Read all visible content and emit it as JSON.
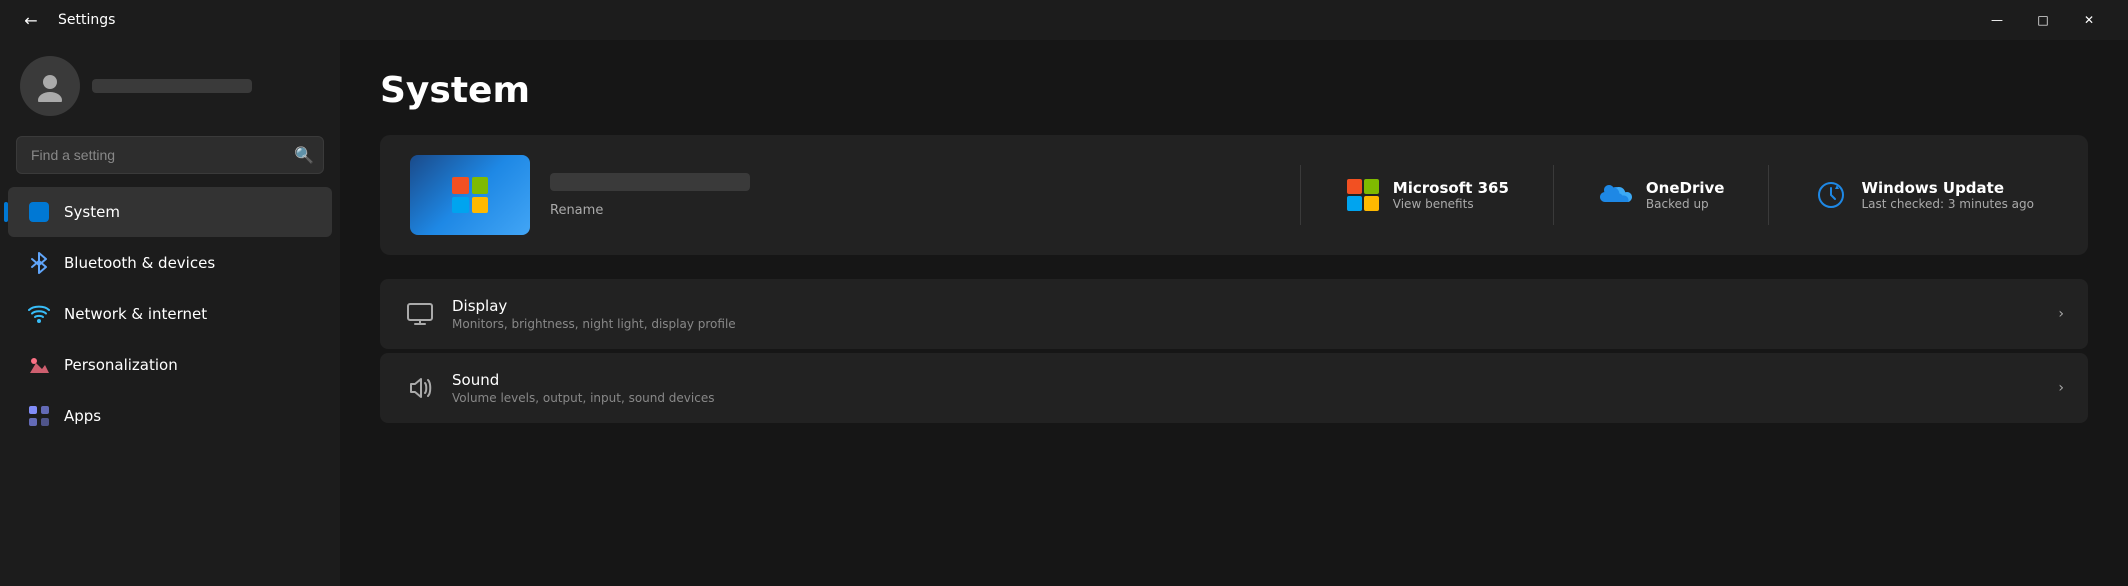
{
  "titlebar": {
    "title": "Settings",
    "back_label": "←",
    "minimize_label": "—",
    "maximize_label": "□",
    "close_label": "✕"
  },
  "sidebar": {
    "search_placeholder": "Find a setting",
    "profile_name_blurred": true,
    "nav_items": [
      {
        "id": "system",
        "label": "System",
        "icon": "system",
        "active": true
      },
      {
        "id": "bluetooth",
        "label": "Bluetooth & devices",
        "icon": "bluetooth",
        "active": false
      },
      {
        "id": "network",
        "label": "Network & internet",
        "icon": "network",
        "active": false
      },
      {
        "id": "personalization",
        "label": "Personalization",
        "icon": "personalization",
        "active": false
      },
      {
        "id": "apps",
        "label": "Apps",
        "icon": "apps",
        "active": false
      }
    ]
  },
  "content": {
    "page_title": "System",
    "pc_name_blurred": true,
    "rename_label": "Rename",
    "services": [
      {
        "id": "microsoft365",
        "name": "Microsoft 365",
        "sub": "View benefits",
        "icon": "m365"
      },
      {
        "id": "onedrive",
        "name": "OneDrive",
        "sub": "Backed up",
        "icon": "onedrive"
      },
      {
        "id": "windowsupdate",
        "name": "Windows Update",
        "sub": "Last checked: 3 minutes ago",
        "icon": "windowsupdate"
      }
    ],
    "settings": [
      {
        "id": "display",
        "name": "Display",
        "desc": "Monitors, brightness, night light, display profile",
        "icon": "display"
      },
      {
        "id": "sound",
        "name": "Sound",
        "desc": "Volume levels, output, input, sound devices",
        "icon": "sound"
      }
    ]
  }
}
